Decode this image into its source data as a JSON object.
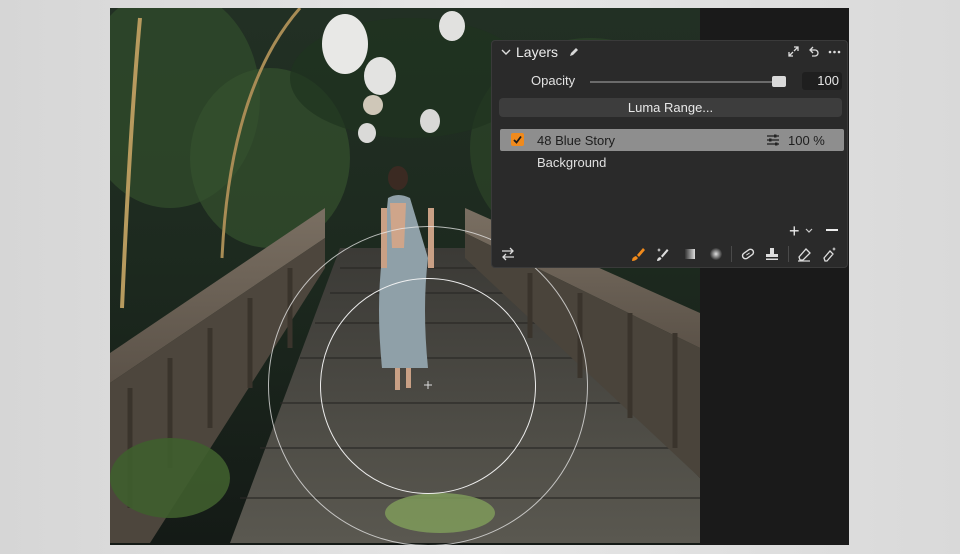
{
  "panel": {
    "title": "Layers",
    "opacity_label": "Opacity",
    "opacity_value": "100",
    "opacity_level": 1.0,
    "luma_button": "Luma Range...",
    "layers": [
      {
        "name": "48 Blue Story",
        "checked": true,
        "opacity": "100 %",
        "selected": true
      },
      {
        "name": "Background",
        "checked": false,
        "selected": false
      }
    ]
  },
  "icons": {
    "collapse": "chevron-down-icon",
    "pin": "pen-icon",
    "expand": "expand-icon",
    "undo": "undo-icon",
    "more": "more-icon",
    "adjust": "adjustments-icon",
    "tools": [
      "swap-icon",
      "brush-icon",
      "magic-brush-icon",
      "gradient-icon",
      "radial-icon",
      "heal-icon",
      "clone-icon",
      "eraser-icon",
      "magic-eraser-icon"
    ]
  },
  "colors": {
    "accent": "#f08a1c",
    "panel_bg": "#2a2a2a",
    "selected_row": "#8e8e8e"
  }
}
